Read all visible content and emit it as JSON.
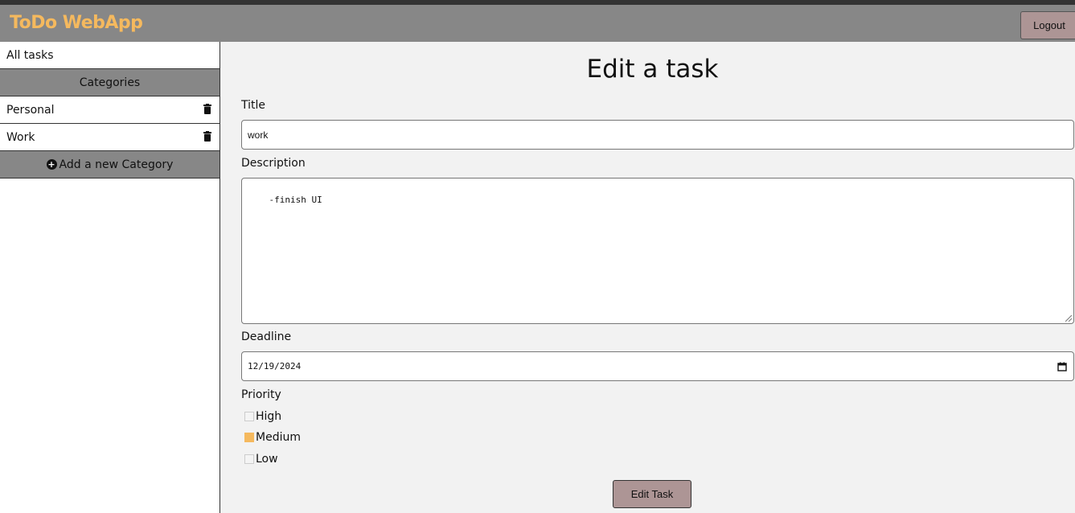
{
  "app": {
    "brand": "ToDo WebApp",
    "logout_label": "Logout",
    "brand_color": "#f5b95e",
    "accent_color": "#ad9595"
  },
  "sidebar": {
    "all_tasks": "All tasks",
    "categories_heading": "Categories",
    "categories": [
      {
        "label": "Personal",
        "icon": "trash-icon"
      },
      {
        "label": "Work",
        "icon": "trash-icon"
      }
    ],
    "add_category_label": "Add a new Category",
    "add_icon": "plus-circle-icon"
  },
  "form": {
    "title": "Edit a task",
    "title_label": "Title",
    "title_value": "work",
    "description_label": "Description",
    "description_value": "-finish UI",
    "deadline_label": "Deadline",
    "deadline_value": "12/19/2024",
    "priority_label": "Priority",
    "priorities": [
      {
        "label": "High",
        "checked": false
      },
      {
        "label": "Medium",
        "checked": true
      },
      {
        "label": "Low",
        "checked": false
      }
    ],
    "submit_label": "Edit Task"
  }
}
